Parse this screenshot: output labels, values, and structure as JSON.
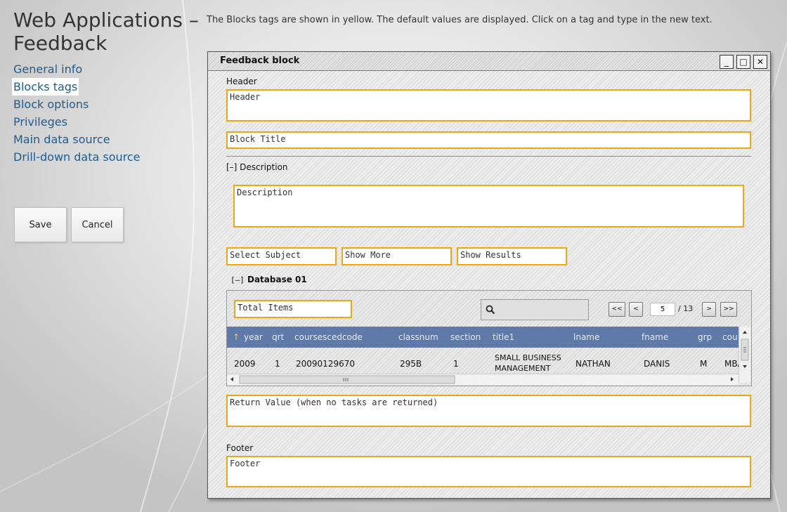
{
  "page": {
    "title": "Web Applications – Feedback",
    "hint": "The Blocks tags are shown in yellow. The default values are displayed. Click on a tag and type in the new text."
  },
  "nav": {
    "items": [
      {
        "label": "General info"
      },
      {
        "label": "Blocks tags"
      },
      {
        "label": "Block options"
      },
      {
        "label": "Privileges"
      },
      {
        "label": "Main data source"
      },
      {
        "label": "Drill-down data source"
      }
    ],
    "active": "Blocks tags"
  },
  "actions": {
    "save": "Save",
    "cancel": "Cancel"
  },
  "window": {
    "title": "Feedback block",
    "controls": {
      "minimize": "_",
      "maximize": "□",
      "close": "✕"
    },
    "header_label": "Header",
    "header_value": "Header",
    "block_title": "Block Title",
    "description_toggle": "[–] Description",
    "description_value": "Description",
    "select_subject": "Select Subject",
    "show_more": "Show More",
    "show_results": "Show Results",
    "database_toggle": "[–]",
    "database_label": "Database 01",
    "total_items": "Total Items",
    "pager": {
      "first": "<<",
      "prev": "<",
      "page": "5",
      "of": "/ 13",
      "next": ">",
      "last": ">>"
    },
    "return_value": "Return Value (when no tasks are returned)",
    "footer_label": "Footer",
    "footer_value": "Footer"
  },
  "table": {
    "sort_icon": "↑",
    "columns": [
      "year",
      "qrt",
      "coursescedcode",
      "classnum",
      "section",
      "title1",
      "lname",
      "fname",
      "grp",
      "cou"
    ],
    "row": [
      "2009",
      "1",
      "20090129670",
      "295B",
      "1",
      "SMALL BUSINESS",
      "MANAGEMENT",
      "NATHAN",
      "DANIS",
      "M",
      "MBA"
    ]
  },
  "colors": {
    "tag_border": "#f0a418",
    "grid_header": "#5f79a8",
    "nav_link": "#1f5c8e"
  }
}
